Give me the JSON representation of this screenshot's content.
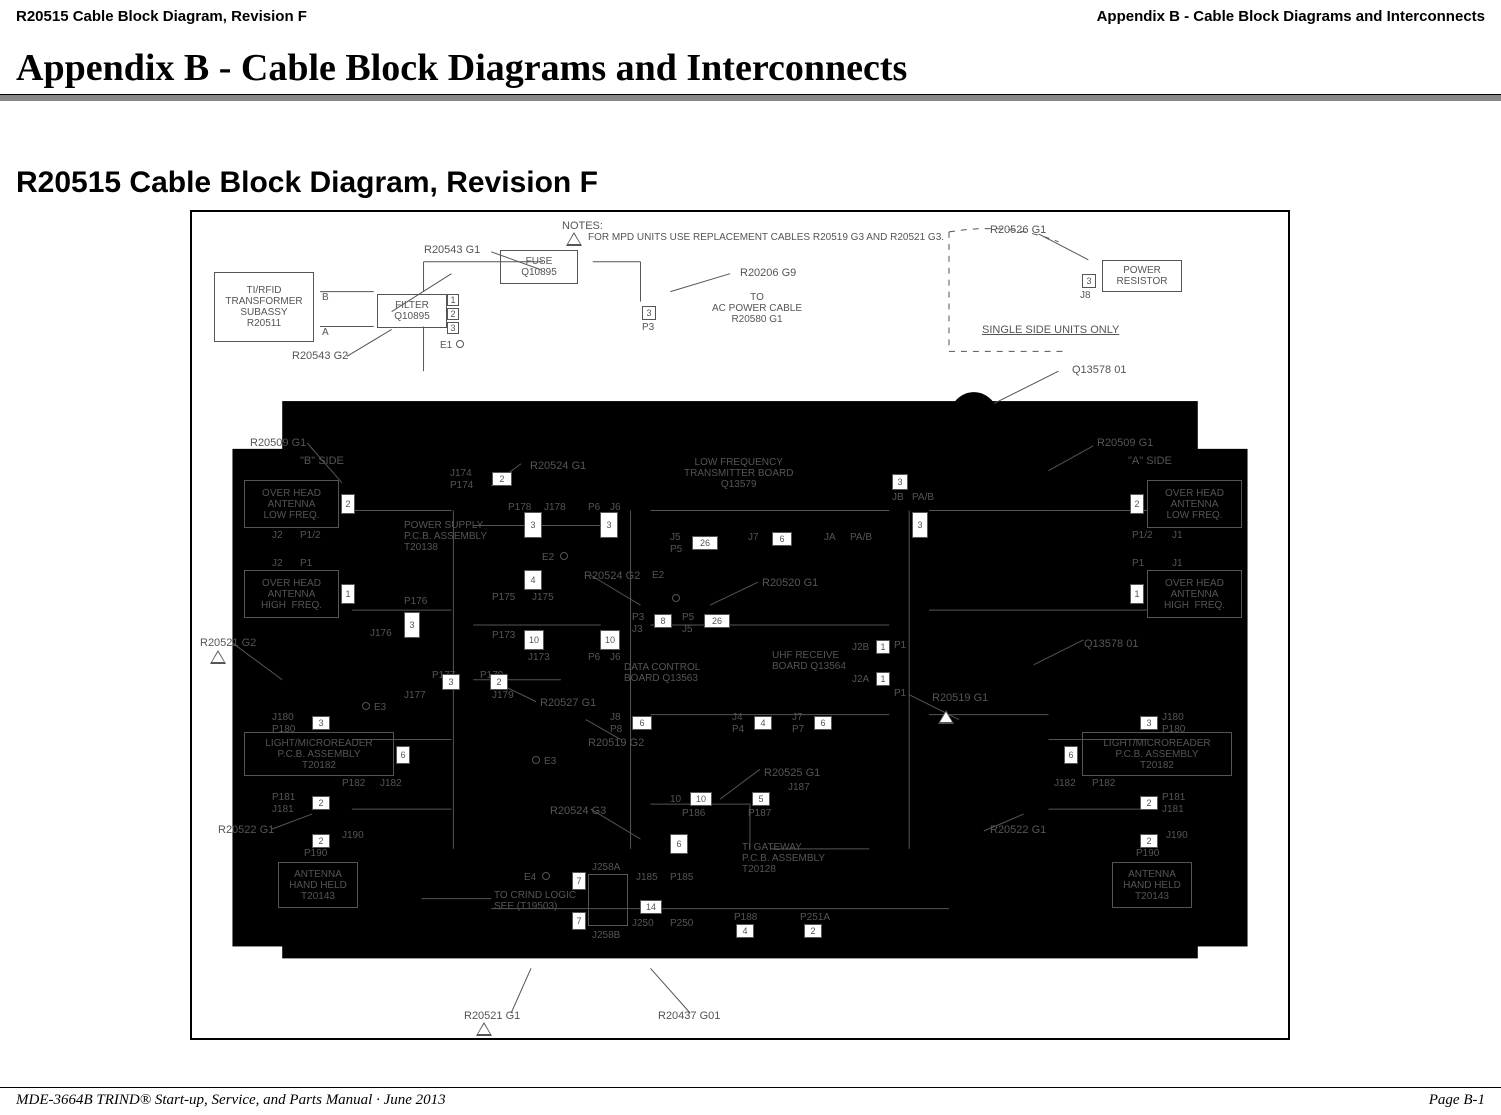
{
  "header": {
    "left": "R20515 Cable Block Diagram, Revision F",
    "right": "Appendix B - Cable Block Diagrams and Interconnects"
  },
  "appendix_title": "Appendix B - Cable Block Diagrams and Interconnects",
  "section_title": "R20515 Cable Block Diagram, Revision F",
  "footer": {
    "left": "MDE-3664B TRIND® Start-up, Service, and Parts Manual · June 2013",
    "right": "Page B-1"
  },
  "diagram": {
    "notes_heading": "NOTES:",
    "note1": "FOR MPD UNITS USE REPLACEMENT CABLES R20519 G3 AND R20521 G3.",
    "to_ac": "TO\nAC POWER CABLE\nR20580 G1",
    "to_crind": "TO CRIND LOGIC\nSEE (T19503)",
    "single_side": "SINGLE SIDE UNITS ONLY",
    "b_side": "\"B\" SIDE",
    "a_side": "\"A\" SIDE",
    "parts": {
      "r20543_g1": "R20543 G1",
      "r20543_g2": "R20543 G2",
      "r20206_g9": "R20206 G9",
      "r20526_g1": "R20526 G1",
      "q13578_01_a": "Q13578 01",
      "q13578_01_b": "Q13578 01",
      "r20509_g1_a": "R20509 G1",
      "r20509_g1_b": "R20509 G1",
      "r20524_g1": "R20524 G1",
      "r20524_g2": "R20524 G2",
      "r20524_g3": "R20524 G3",
      "r20520_g1": "R20520 G1",
      "r20521_g1": "R20521 G1",
      "r20521_g2": "R20521 G2",
      "r20522_g1_a": "R20522 G1",
      "r20522_g1_b": "R20522 G1",
      "r20525_g1": "R20525 G1",
      "r20527_g1": "R20527 G1",
      "r20519_g1": "R20519 G1",
      "r20519_g2": "R20519 G2",
      "r20437_g01": "R20437 G01"
    },
    "boxes": {
      "transformer": "TI/RFID\nTRANSFORMER\nSUBASSY\nR20511",
      "fuse": "FUSE\nQ10895",
      "filter": "FILTER\nQ10895",
      "power_resistor": "POWER\nRESISTOR",
      "lf_board": "LOW FREQUENCY\nTRANSMITTER BOARD\nQ13579",
      "power_supply": "POWER SUPPLY\nP.C.B. ASSEMBLY\nT20138",
      "data_control": "DATA CONTROL\nBOARD Q13563",
      "uhf_receive": "UHF RECEIVE\nBOARD Q13564",
      "ti_gateway": "TI GATEWAY\nP.C.B. ASSEMBLY\nT20128",
      "overhead_lf_b": "OVER HEAD\nANTENNA\nLOW FREQ.",
      "overhead_hf_b": "OVER HEAD\nANTENNA\nHIGH  FREQ.",
      "overhead_lf_a": "OVER HEAD\nANTENNA\nLOW FREQ.",
      "overhead_hf_a": "OVER HEAD\nANTENNA\nHIGH  FREQ.",
      "light_micro_b": "LIGHT/MICROREADER\nP.C.B. ASSEMBLY\nT20182",
      "light_micro_a": "LIGHT/MICROREADER\nP.C.B. ASSEMBLY\nT20182",
      "antenna_hh_b": "ANTENNA\nHAND HELD\nT20143",
      "antenna_hh_a": "ANTENNA\nHAND HELD\nT20143"
    },
    "pins": {
      "e1": "E1",
      "e2": "E2",
      "e3": "E3",
      "e4": "E4",
      "p3": "P3",
      "p1_2_b": "P1/2",
      "p1_2_a": "P1/2",
      "j1_b": "J1",
      "j1_a": "J1",
      "j2_b": "J2",
      "j2_a": "J2",
      "j2_top": "J2",
      "p1_b": "P1",
      "p1_a": "P1",
      "j174": "J174",
      "p174": "P174",
      "p178": "P178",
      "j178": "J178",
      "p6": "P6",
      "j6": "J6",
      "p175": "P175",
      "j175": "J175",
      "j5_a": "J5",
      "p5_a": "P5",
      "j7_a": "J7",
      "ja": "JA",
      "pa_b_a": "PA/B",
      "j8": "J8",
      "jb": "JB",
      "pa_b_b": "PA/B",
      "p3_dc": "P3",
      "j3_dc": "J3",
      "p5_dc": "P5",
      "j5_dc": "J5",
      "p173": "P173",
      "j173": "J173",
      "p6_dc": "P6",
      "j6_dc": "J6",
      "p176": "P176",
      "j176": "J176",
      "p177": "P177",
      "j177": "J177",
      "p179": "P179",
      "j179": "J179",
      "j8b": "J8",
      "p8": "P8",
      "j4": "J4",
      "p4": "P4",
      "j7_b": "J7",
      "p7": "P7",
      "j2b": "J2B",
      "j2a": "J2A",
      "p1_u1": "P1",
      "p1_u2": "P1",
      "j180_b": "J180",
      "p180_b": "P180",
      "j180_a": "J180",
      "p180_a": "P180",
      "p181_b": "P181",
      "j181_b": "J181",
      "p181_a": "P181",
      "j181_a": "J181",
      "p182_b": "P182",
      "j182_b": "J182",
      "p182_a": "P182",
      "j182_a": "J182",
      "j190_b": "J190",
      "p190_b": "P190",
      "j190_a": "J190",
      "p190_a": "P190",
      "p186": "P186",
      "p187": "P187",
      "j187": "J187",
      "j185": "J185",
      "p185": "P185",
      "j250": "J250",
      "p250": "P250",
      "p188": "P188",
      "p251a": "P251A",
      "j258a": "J258A",
      "j258b": "J258B",
      "n2": "2",
      "n3": "3",
      "n4": "4",
      "n5": "5",
      "n6": "6",
      "n7": "7",
      "n8": "8",
      "n10": "10",
      "n14": "14",
      "n26": "26",
      "n1": "1",
      "n2b": "2",
      "n3b": "3",
      "n6b": "6",
      "n6c": "6",
      "n2c": "2",
      "n2d": "2",
      "n2e": "2",
      "n3c": "3",
      "n3d": "3",
      "n1a": "1",
      "n26b": "26",
      "n2f": "2",
      "n4b": "4",
      "n5b": "5",
      "n6d": "6",
      "n7b": "7",
      "n10b": "10",
      "n10c": "10"
    }
  }
}
